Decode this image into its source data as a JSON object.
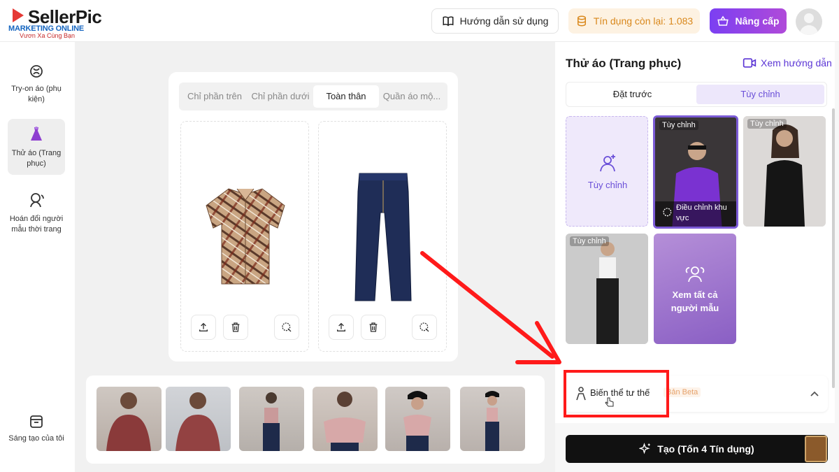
{
  "app": {
    "logo_text": "SellerPic",
    "logo_overlay": "MARKETING ONLINE",
    "logo_slogan": "Vươn Xa Cùng Bạn"
  },
  "header": {
    "guide_label": "Hướng dẫn sử dụng",
    "credit_label": "Tín dụng còn lại: 1.083",
    "upgrade_label": "Nâng cấp"
  },
  "sidebar": {
    "items": [
      {
        "label": "Try-on áo (phụ kiện)",
        "icon": "accessory-icon"
      },
      {
        "label": "Thử áo (Trang phục)",
        "icon": "dress-icon",
        "active": true
      },
      {
        "label": "Hoán đổi người mẫu thời trang",
        "icon": "model-swap-icon"
      },
      {
        "label": "Sáng tạo của tôi",
        "icon": "my-creations-icon"
      }
    ]
  },
  "editor": {
    "tabs": [
      "Chỉ phần trên",
      "Chỉ phần dưới",
      "Toàn thân",
      "Quần áo mộ..."
    ],
    "active_tab": 2,
    "slots": [
      {
        "item": "plaid-shirt"
      },
      {
        "item": "denim-jeans"
      }
    ]
  },
  "right_panel": {
    "title": "Thử áo (Trang phục)",
    "guide_link": "Xem hướng dẫn",
    "segments": [
      "Đặt trước",
      "Tùy chỉnh"
    ],
    "active_segment": 1,
    "custom_tile_label": "Tùy chỉnh",
    "tile_tag": "Tùy chỉnh",
    "adjust_area_label": "Điều chỉnh khu vực",
    "view_all_label": "Xem tất cả người mẫu",
    "pose_variant_label": "Biến thể tư thế",
    "beta_label": "Bản Beta",
    "create_label": "Tạo (Tốn 4 Tín dụng)"
  },
  "colors": {
    "accent": "#7b3ff2",
    "credit_text": "#d9881c",
    "highlight": "#ff1a1a"
  }
}
